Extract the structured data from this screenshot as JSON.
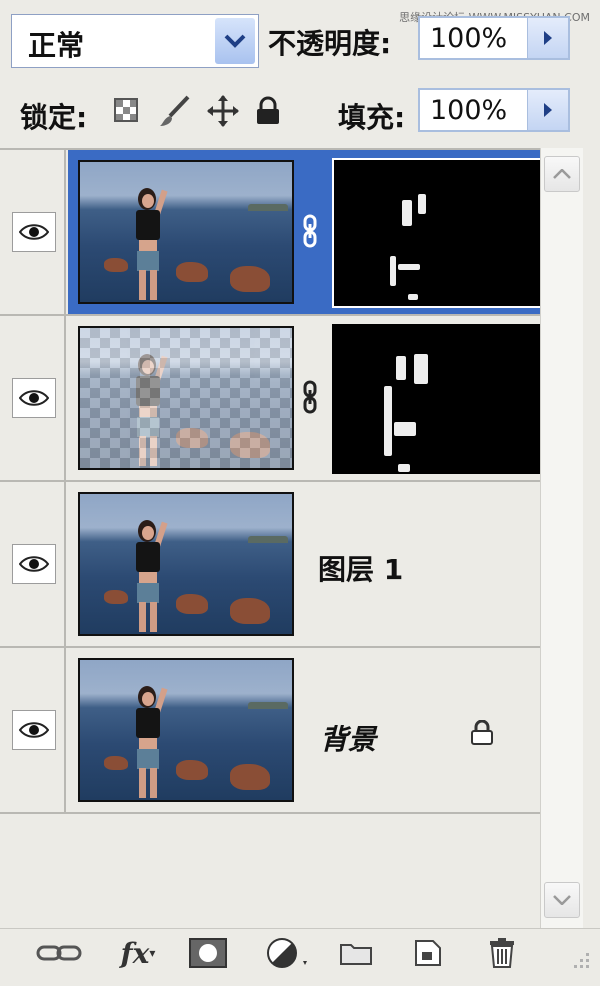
{
  "watermark": "思缘设计论坛 WWW.MISSYUAN.COM",
  "blend_mode": {
    "value": "正常"
  },
  "opacity": {
    "label": "不透明度:",
    "value": "100%"
  },
  "lock": {
    "label": "锁定:"
  },
  "fill": {
    "label": "填充:",
    "value": "100%"
  },
  "layers": [
    {
      "name": "",
      "selected": true,
      "has_mask": true,
      "visible": true
    },
    {
      "name": "",
      "selected": false,
      "has_mask": true,
      "visible": true
    },
    {
      "name": "图层 1",
      "selected": false,
      "has_mask": false,
      "visible": true
    },
    {
      "name": "背景",
      "selected": false,
      "has_mask": false,
      "visible": true,
      "locked": true
    }
  ],
  "toolbar": {
    "icons": [
      "link-layers-icon",
      "fx-icon",
      "add-mask-icon",
      "adjustment-layer-icon",
      "new-group-icon",
      "new-layer-icon",
      "delete-layer-icon"
    ],
    "fx_label": "fx"
  }
}
